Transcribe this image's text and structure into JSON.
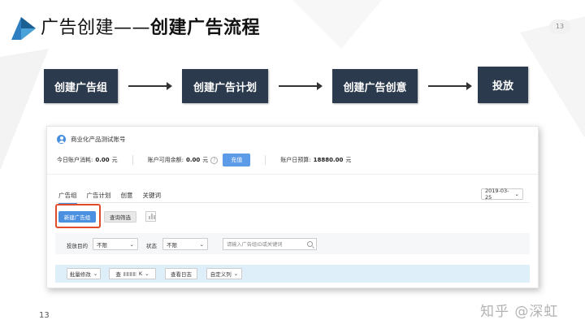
{
  "slide": {
    "title_prefix": "广告创建——",
    "title_bold": "创建广告流程",
    "page_badge": "13",
    "page_number": "13",
    "watermark": "知乎 @深虹",
    "accent_color": "#2b3a4d"
  },
  "flow": {
    "steps": [
      "创建广告组",
      "创建广告计划",
      "创建广告创意",
      "投放"
    ]
  },
  "console": {
    "account_name": "商业化产品测试账号",
    "stats": {
      "today_spend_label": "今日账户消耗:",
      "today_spend_value": "0.00",
      "unit": "元",
      "available_label": "账户可用余额:",
      "available_value": "0.00",
      "recharge_button": "充值",
      "daily_budget_label": "账户日预算:",
      "daily_budget_value": "18880.00"
    },
    "tabs": [
      "广告组",
      "广告计划",
      "创意",
      "关键词"
    ],
    "date": "2019-03-25",
    "new_group_button": "新建广告组",
    "filter_button": "查询筛选",
    "filters": {
      "goal_label": "投放目的",
      "goal_value": "不限",
      "status_label": "状态",
      "status_value": "不限",
      "search_placeholder": "请输入广告组ID或关键词"
    },
    "toolbar": {
      "batch_edit": "批量修改",
      "query_prefix": "查",
      "query_suffix": "K",
      "view_log": "查看日志",
      "custom_columns": "自定义列"
    },
    "accent_blue": "#4a90e2",
    "highlight_red": "#e04b2a"
  }
}
